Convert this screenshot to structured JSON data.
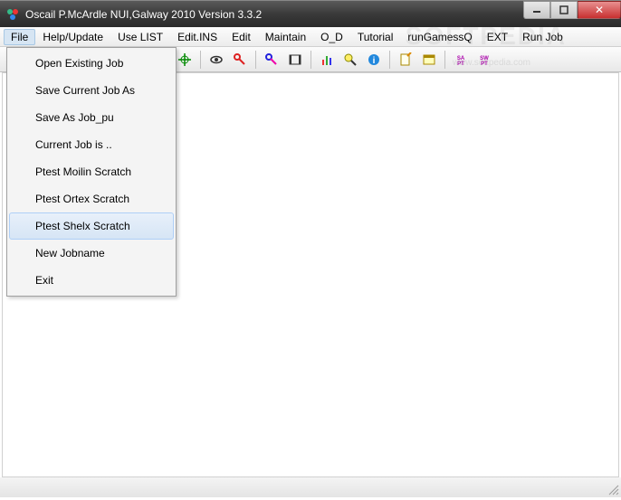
{
  "window": {
    "title": "Oscail P.McArdle NUI,Galway 2010 Version 3.3.2"
  },
  "watermark": {
    "big": "SOFTPEDIA",
    "small": "www.softpedia.com"
  },
  "menubar": {
    "items": [
      {
        "label": "File",
        "open": true
      },
      {
        "label": "Help/Update"
      },
      {
        "label": "Use LIST"
      },
      {
        "label": "Edit.INS"
      },
      {
        "label": "Edit"
      },
      {
        "label": "Maintain"
      },
      {
        "label": "O_D"
      },
      {
        "label": "Tutorial"
      },
      {
        "label": "runGamessQ"
      },
      {
        "label": "EXT"
      },
      {
        "label": "Run Job"
      }
    ]
  },
  "file_menu": {
    "items": [
      {
        "label": "Open Existing Job"
      },
      {
        "label": "Save Current Job As"
      },
      {
        "label": "Save As Job_pu"
      },
      {
        "label": "Current Job is .."
      },
      {
        "label": "Ptest Moilin Scratch"
      },
      {
        "label": "Ptest Ortex Scratch"
      },
      {
        "label": "Ptest Shelx Scratch",
        "hover": true
      },
      {
        "label": "New Jobname"
      },
      {
        "label": "Exit"
      }
    ]
  },
  "toolbar": {
    "icons": [
      "crosshair-icon",
      "eye-icon",
      "key-red-icon",
      "key-blue-icon",
      "film-icon",
      "chart-icon",
      "magnify-icon",
      "info-icon",
      "edit-doc-icon",
      "window-icon",
      "sapt-a-icon",
      "swpt-icon"
    ]
  }
}
